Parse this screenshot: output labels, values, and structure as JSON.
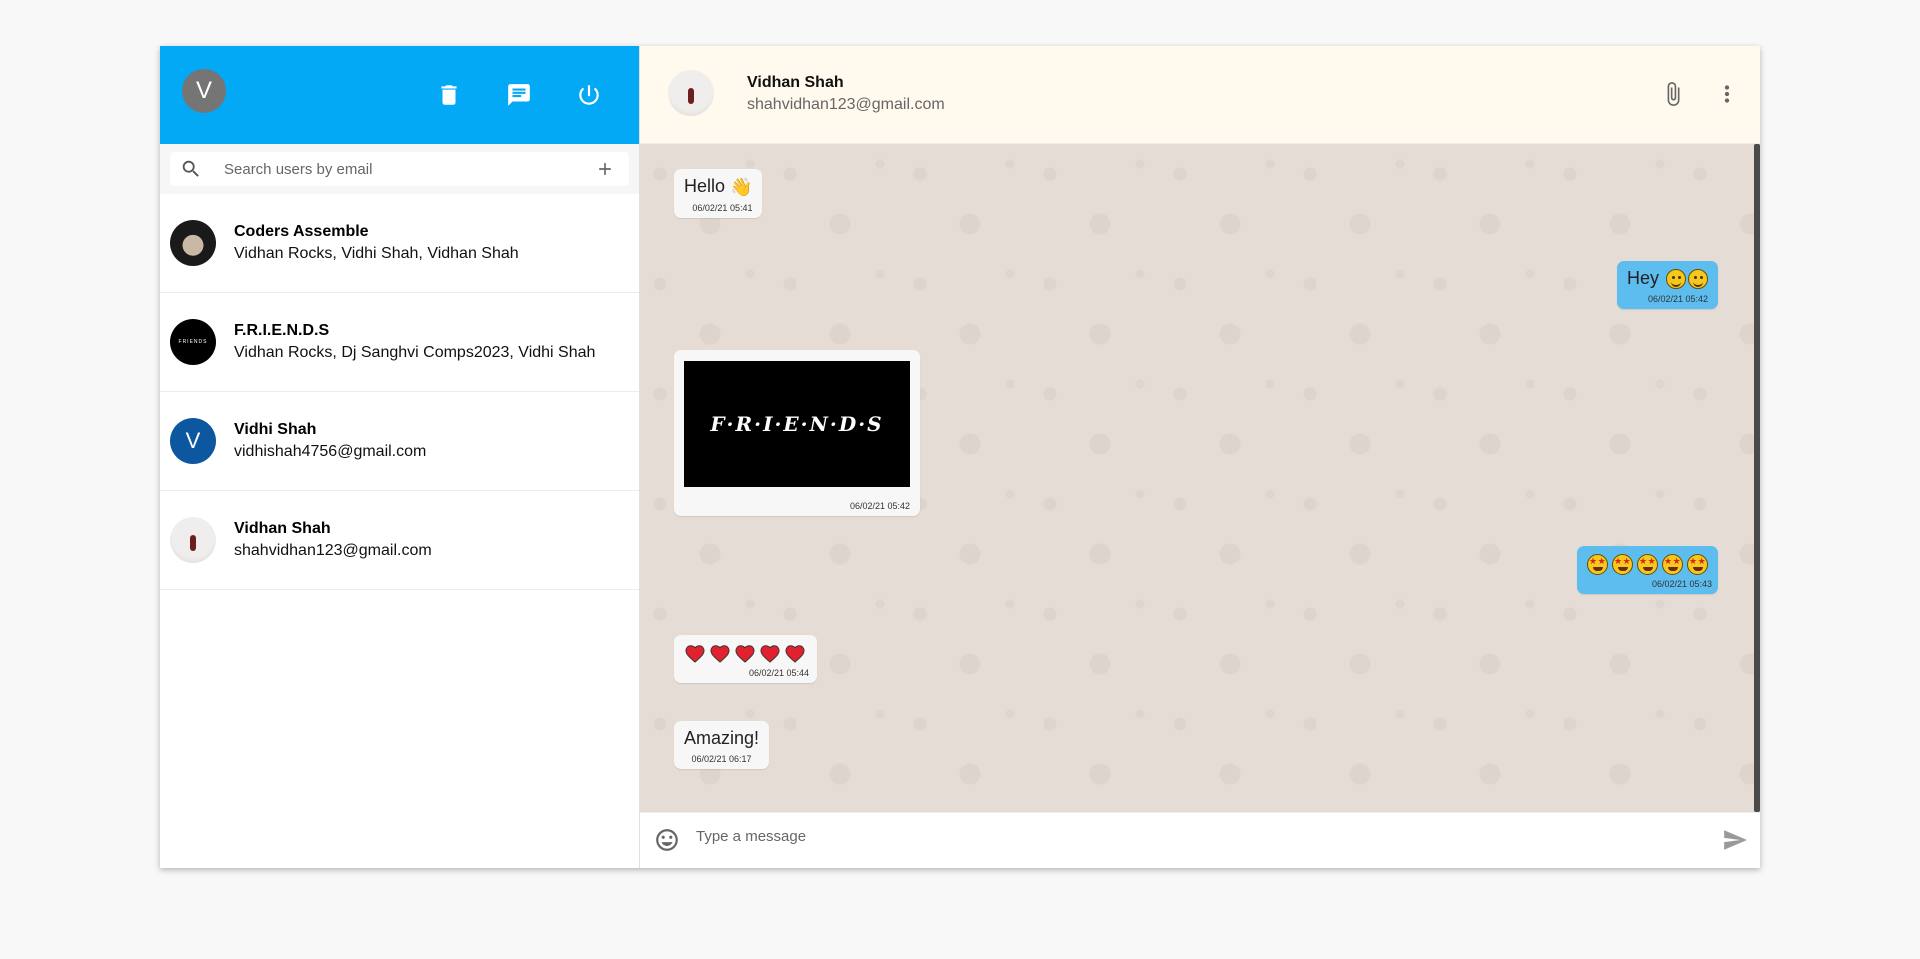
{
  "sidebar": {
    "user_avatar_initial": "V",
    "search_placeholder": "Search users by email",
    "contacts": [
      {
        "name": "Coders Assemble",
        "subtitle": "Vidhan Rocks, Vidhi Shah, Vidhan Shah",
        "avatar": "group-photo"
      },
      {
        "name": "F.R.I.E.N.D.S",
        "subtitle": "Vidhan Rocks, Dj Sanghvi Comps2023, Vidhi Shah",
        "avatar": "friends-logo",
        "avatar_text": "FRIENDS"
      },
      {
        "name": "Vidhi Shah",
        "subtitle": "vidhishah4756@gmail.com",
        "avatar": "initial",
        "avatar_initial": "V"
      },
      {
        "name": "Vidhan Shah",
        "subtitle": "shahvidhan123@gmail.com",
        "avatar": "photo"
      }
    ]
  },
  "chat": {
    "contact_name": "Vidhan Shah",
    "contact_email": "shahvidhan123@gmail.com",
    "messages": [
      {
        "direction": "in",
        "text": "Hello",
        "emoji": "waving-hand",
        "time": "06/02/21 05:41"
      },
      {
        "direction": "out",
        "text": "Hey",
        "emoji": "grinning-face x2",
        "time": "06/02/21 05:42"
      },
      {
        "direction": "in",
        "type": "image",
        "image_text": "F·R·I·E·N·D·S",
        "time": "06/02/21 05:42"
      },
      {
        "direction": "out",
        "emoji": "star-struck x5",
        "time": "06/02/21 05:43"
      },
      {
        "direction": "in",
        "emoji": "red-heart x5",
        "time": "06/02/21 05:44"
      },
      {
        "direction": "in",
        "text": "Amazing!",
        "time": "06/02/21 06:17"
      }
    ],
    "composer_placeholder": "Type a message"
  },
  "colors": {
    "sidebar_header": "#03a9f4",
    "chat_header": "#fffaed",
    "chat_background": "#e5ddd5",
    "outgoing_bubble": "#5ebdef",
    "incoming_bubble": "#f7f7f7"
  },
  "icons": [
    "delete-icon",
    "new-chat-icon",
    "power-icon",
    "search-icon",
    "add-icon",
    "attach-icon",
    "more-vert-icon",
    "emoji-icon",
    "send-icon"
  ]
}
